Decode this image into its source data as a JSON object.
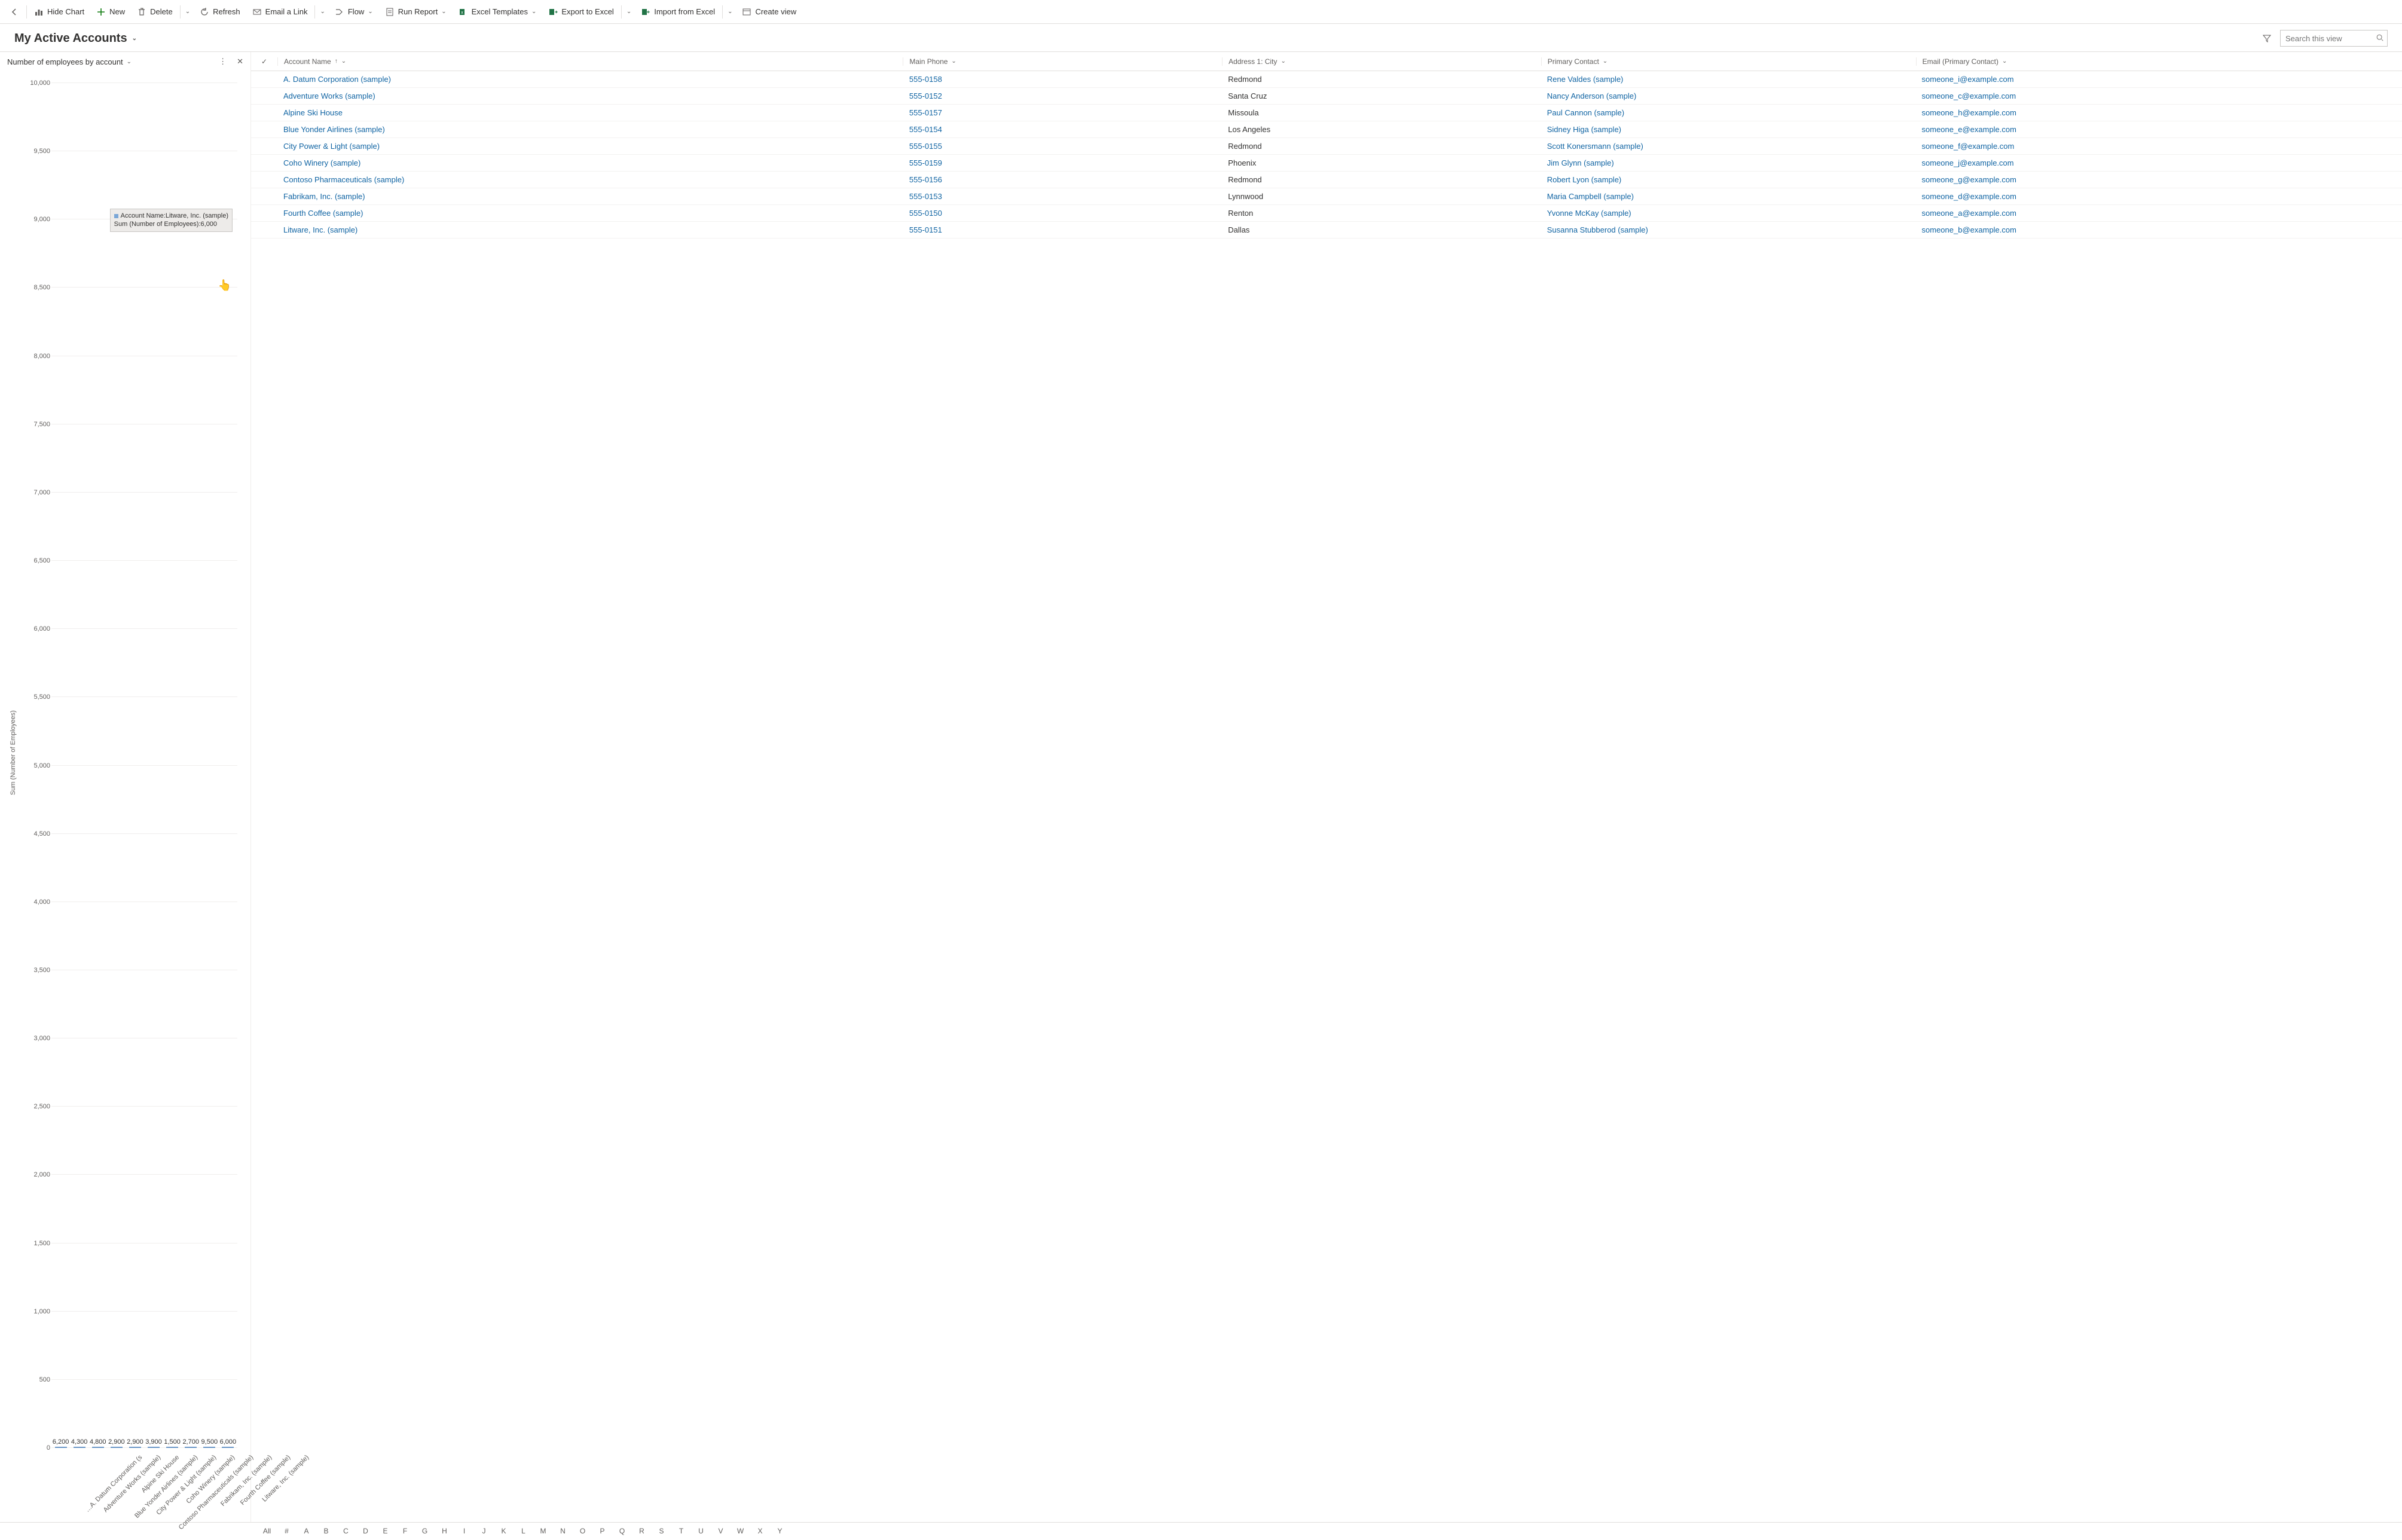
{
  "toolbar": {
    "back": "",
    "hide_chart": "Hide Chart",
    "new": "New",
    "delete": "Delete",
    "refresh": "Refresh",
    "email_link": "Email a Link",
    "flow": "Flow",
    "run_report": "Run Report",
    "excel_templates": "Excel Templates",
    "export_excel": "Export to Excel",
    "import_excel": "Import from Excel",
    "create_view": "Create view"
  },
  "header": {
    "view_title": "My Active Accounts",
    "search_placeholder": "Search this view"
  },
  "chart": {
    "title": "Number of employees by account",
    "yaxis_label": "Sum (Number of Employees)",
    "tooltip_line1": "Account Name:Litware, Inc. (sample)",
    "tooltip_line2": "Sum (Number of Employees):6,000"
  },
  "chart_data": {
    "type": "bar",
    "title": "Number of employees by account",
    "xlabel": "",
    "ylabel": "Sum (Number of Employees)",
    "ylim": [
      0,
      10000
    ],
    "ytick_step": 500,
    "categories": [
      "A. Datum Corporation (s…",
      "Adventure Works (sample)",
      "Alpine Ski House",
      "Blue Yonder Airlines (sample)",
      "City Power & Light (sample)",
      "Coho Winery (sample)",
      "Contoso Pharmaceuticals (sample)",
      "Fabrikam, Inc. (sample)",
      "Fourth Coffee (sample)",
      "Litware, Inc. (sample)"
    ],
    "values": [
      6200,
      4300,
      4800,
      2900,
      2900,
      3900,
      1500,
      2700,
      9500,
      6000
    ],
    "value_labels": [
      "6,200",
      "4,300",
      "4,800",
      "2,900",
      "2,900",
      "3,900",
      "1,500",
      "2,700",
      "9,500",
      "6,000"
    ],
    "hover_index": 9
  },
  "grid": {
    "columns": {
      "name": "Account Name",
      "phone": "Main Phone",
      "city": "Address 1: City",
      "contact": "Primary Contact",
      "email": "Email (Primary Contact)"
    },
    "rows": [
      {
        "name": "A. Datum Corporation (sample)",
        "phone": "555-0158",
        "city": "Redmond",
        "contact": "Rene Valdes (sample)",
        "email": "someone_i@example.com"
      },
      {
        "name": "Adventure Works (sample)",
        "phone": "555-0152",
        "city": "Santa Cruz",
        "contact": "Nancy Anderson (sample)",
        "email": "someone_c@example.com"
      },
      {
        "name": "Alpine Ski House",
        "phone": "555-0157",
        "city": "Missoula",
        "contact": "Paul Cannon (sample)",
        "email": "someone_h@example.com"
      },
      {
        "name": "Blue Yonder Airlines (sample)",
        "phone": "555-0154",
        "city": "Los Angeles",
        "contact": "Sidney Higa (sample)",
        "email": "someone_e@example.com"
      },
      {
        "name": "City Power & Light (sample)",
        "phone": "555-0155",
        "city": "Redmond",
        "contact": "Scott Konersmann (sample)",
        "email": "someone_f@example.com"
      },
      {
        "name": "Coho Winery (sample)",
        "phone": "555-0159",
        "city": "Phoenix",
        "contact": "Jim Glynn (sample)",
        "email": "someone_j@example.com"
      },
      {
        "name": "Contoso Pharmaceuticals (sample)",
        "phone": "555-0156",
        "city": "Redmond",
        "contact": "Robert Lyon (sample)",
        "email": "someone_g@example.com"
      },
      {
        "name": "Fabrikam, Inc. (sample)",
        "phone": "555-0153",
        "city": "Lynnwood",
        "contact": "Maria Campbell (sample)",
        "email": "someone_d@example.com"
      },
      {
        "name": "Fourth Coffee (sample)",
        "phone": "555-0150",
        "city": "Renton",
        "contact": "Yvonne McKay (sample)",
        "email": "someone_a@example.com"
      },
      {
        "name": "Litware, Inc. (sample)",
        "phone": "555-0151",
        "city": "Dallas",
        "contact": "Susanna Stubberod (sample)",
        "email": "someone_b@example.com"
      }
    ]
  },
  "alpha": [
    "All",
    "#",
    "A",
    "B",
    "C",
    "D",
    "E",
    "F",
    "G",
    "H",
    "I",
    "J",
    "K",
    "L",
    "M",
    "N",
    "O",
    "P",
    "Q",
    "R",
    "S",
    "T",
    "U",
    "V",
    "W",
    "X",
    "Y"
  ],
  "yticks": [
    "0",
    "500",
    "1,000",
    "1,500",
    "2,000",
    "2,500",
    "3,000",
    "3,500",
    "4,000",
    "4,500",
    "5,000",
    "5,500",
    "6,000",
    "6,500",
    "7,000",
    "7,500",
    "8,000",
    "8,500",
    "9,000",
    "9,500",
    "10,000"
  ]
}
